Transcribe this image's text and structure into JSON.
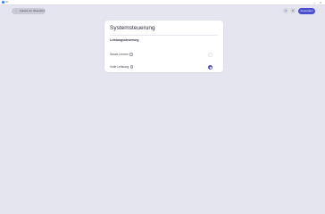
{
  "titlebar": {
    "app_name": "UI",
    "minimize": "–",
    "close": "×"
  },
  "toolbar": {
    "back_label": "Zurück zur Übersicht",
    "back_icon": "arrow-left-icon",
    "icon_1": "history-icon",
    "icon_2": "settings-icon",
    "primary_label": "Anwenden"
  },
  "card": {
    "title": "Systemsteuerung",
    "section_title": "Leistungssteuerung",
    "options": [
      {
        "label": "Smart-Lernen",
        "checked": false
      },
      {
        "label": "Volle Leistung",
        "checked": true
      }
    ]
  },
  "colors": {
    "background": "#e4e5ef",
    "accent": "#4a4fd0"
  }
}
